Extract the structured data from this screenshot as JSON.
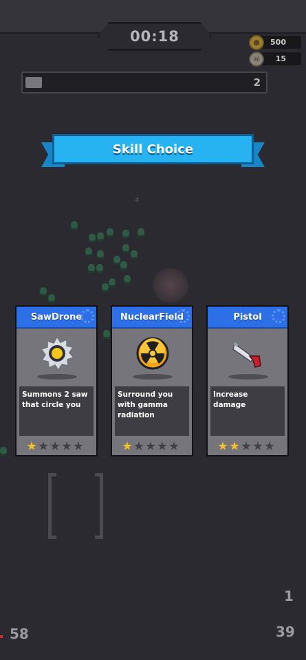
{
  "hud": {
    "timer": "00:18",
    "coins": "500",
    "kills": "15",
    "xp_level": "2",
    "xp_progress": 0.07,
    "coin_icon": "coin-icon",
    "skull_icon": "skull-icon"
  },
  "dialog": {
    "title": "Skill Choice"
  },
  "cards": [
    {
      "name": "SawDrone",
      "description": "Summons 2 saw that circle you",
      "stars": 1,
      "max_stars": 5,
      "icon": "saw-blade-icon"
    },
    {
      "name": "NuclearField",
      "description": "Surround you with gamma radiation",
      "stars": 1,
      "max_stars": 5,
      "icon": "radiation-icon"
    },
    {
      "name": "Pistol",
      "description": "Increase damage",
      "stars": 2,
      "max_stars": 5,
      "icon": "pistol-icon"
    }
  ],
  "field": {
    "floating_damage": "4",
    "left_counter": "58",
    "right_counter_top": "1",
    "right_counter_bottom": "39"
  },
  "colors": {
    "background": "#2a2a30",
    "ribbon": "#27b3f2",
    "card_header": "#2c6fe6",
    "star_on": "#f3c12c"
  }
}
